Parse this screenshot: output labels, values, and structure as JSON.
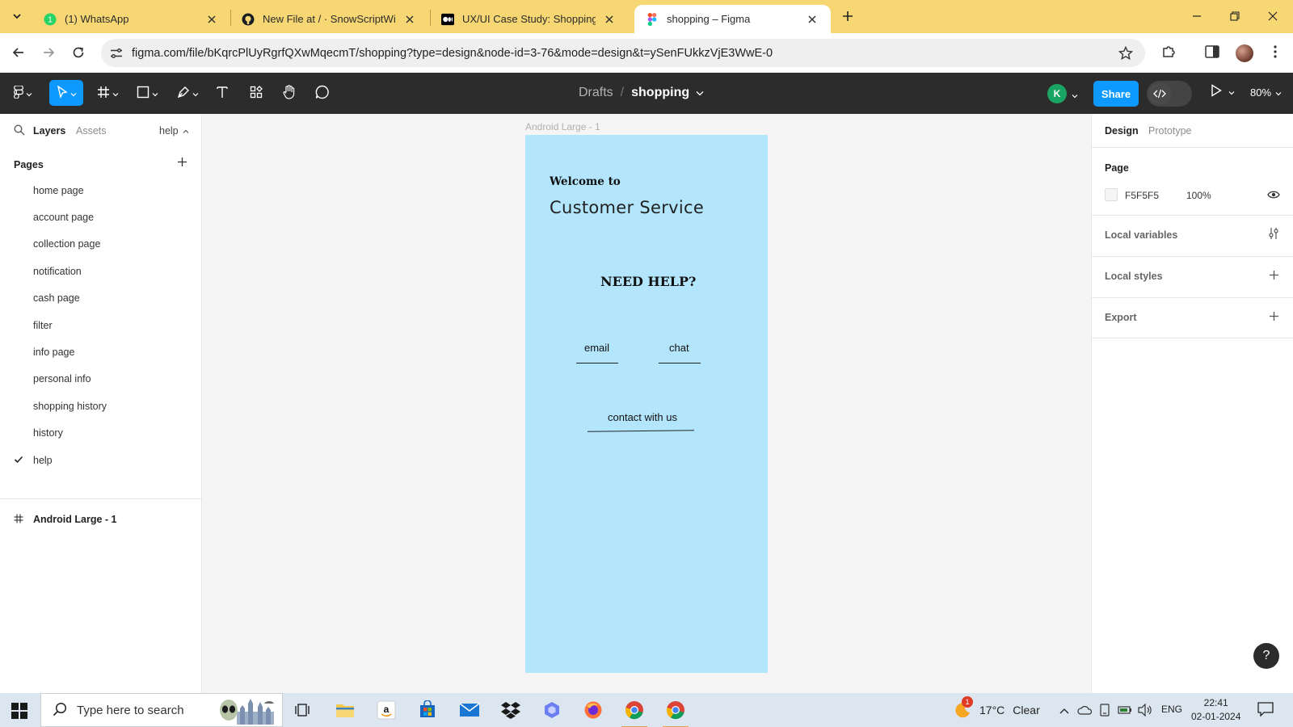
{
  "browser": {
    "tabs": [
      {
        "title": "(1) WhatsApp",
        "icon": "whatsapp-icon",
        "active": false
      },
      {
        "title": "New File at / · SnowScriptWinte",
        "icon": "github-icon",
        "active": false
      },
      {
        "title": "UX/UI Case Study: Shopping Ap",
        "icon": "medium-icon",
        "active": false
      },
      {
        "title": "shopping – Figma",
        "icon": "figma-icon",
        "active": true
      }
    ],
    "url": "figma.com/file/bKqrcPlUyRgrfQXwMqecmT/shopping?type=design&node-id=3-76&mode=design&t=ySenFUkkzVjE3WwE-0",
    "accent": "#f7d774"
  },
  "figma_toolbar": {
    "breadcrumb_drafts": "Drafts",
    "breadcrumb_separator": "/",
    "file_name": "shopping",
    "user_initial": "K",
    "share_label": "Share",
    "zoom_label": "80%"
  },
  "left_panel": {
    "tab_layers": "Layers",
    "tab_assets": "Assets",
    "current_page_selector": "help",
    "pages_header": "Pages",
    "pages": [
      {
        "label": "home page",
        "current": false
      },
      {
        "label": "account page",
        "current": false
      },
      {
        "label": "collection page",
        "current": false
      },
      {
        "label": "notification",
        "current": false
      },
      {
        "label": "cash page",
        "current": false
      },
      {
        "label": "filter",
        "current": false
      },
      {
        "label": "info page",
        "current": false
      },
      {
        "label": "personal info",
        "current": false
      },
      {
        "label": "shopping history",
        "current": false
      },
      {
        "label": "history",
        "current": false
      },
      {
        "label": "help",
        "current": true
      }
    ],
    "layers": [
      {
        "label": "Android Large - 1"
      }
    ]
  },
  "canvas": {
    "background": "#f5f5f5",
    "frame_label": "Android Large - 1",
    "frame_fill": "#b3e5fc",
    "frame_content": {
      "welcome": "Welcome to",
      "title": "Customer Service",
      "need_help": "NEED HELP?",
      "email_link": "email",
      "chat_link": "chat",
      "contact_link": "contact with us"
    }
  },
  "right_panel": {
    "tab_design": "Design",
    "tab_prototype": "Prototype",
    "page_section_title": "Page",
    "page_color_hex": "F5F5F5",
    "page_opacity": "100%",
    "local_variables": "Local variables",
    "local_styles": "Local styles",
    "export": "Export",
    "help_label": "?"
  },
  "taskbar": {
    "search_placeholder": "Type here to search",
    "weather_badge": "1",
    "weather_temp": "17°C",
    "weather_cond": "Clear",
    "language": "ENG",
    "time": "22:41",
    "date": "02-01-2024"
  }
}
